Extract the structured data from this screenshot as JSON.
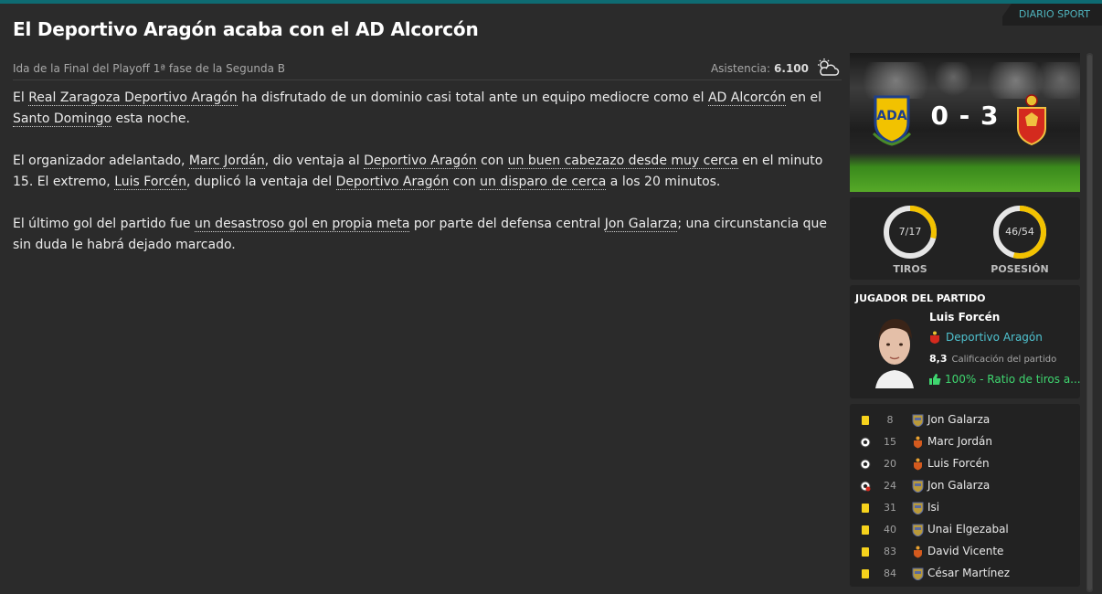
{
  "source": "DIARIO SPORT",
  "headline": "El Deportivo Aragón acaba con el AD Alcorcón",
  "round": "Ida de la Final del Playoff 1ª fase de la Segunda B",
  "attendance": {
    "label": "Asistencia:",
    "value": "6.100",
    "icon": "partly-cloudy-icon"
  },
  "article": {
    "p1": [
      "El ",
      "Real Zaragoza Deportivo Aragón",
      " ha disfrutado de un dominio casi total ante un equipo mediocre como el ",
      "AD Alcorcón",
      " en el ",
      "Santo Domingo",
      " esta noche."
    ],
    "p2": [
      "El organizador adelantado, ",
      "Marc Jordán",
      ", dio ventaja al ",
      "Deportivo Aragón",
      " con ",
      "un buen cabezazo desde muy cerca",
      " en el minuto 15. El extremo, ",
      "Luis Forcén",
      ", duplicó la ventaja del ",
      "Deportivo Aragón",
      " con ",
      "un disparo de cerca",
      " a los 20 minutos."
    ],
    "p3": [
      "El último gol del partido fue ",
      "un desastroso gol en propia meta",
      " por parte del defensa central ",
      "Jon Galarza",
      "; una circunstancia que sin duda le habrá dejado marcado."
    ]
  },
  "match": {
    "score": "0 - 3",
    "home_badge": "alcorcon-crest-icon",
    "away_badge": "zaragoza-crest-icon"
  },
  "stats": {
    "shots": {
      "value": "7/17",
      "label": "TIROS",
      "fraction": 0.29
    },
    "possession": {
      "value": "46/54",
      "label": "POSESIÓN",
      "fraction": 0.54
    }
  },
  "motm": {
    "title": "JUGADOR DEL PARTIDO",
    "name": "Luis Forcén",
    "club": "Deportivo Aragón",
    "rating": "8,3",
    "rating_label": "Calificación del partido",
    "stat": "100% - Ratio de tiros a..."
  },
  "events": [
    {
      "icon": "yellow-card-icon",
      "minute": "8",
      "badge": "alcorcon",
      "player": "Jon Galarza"
    },
    {
      "icon": "goal-ball-icon",
      "minute": "15",
      "badge": "zaragoza",
      "player": "Marc Jordán"
    },
    {
      "icon": "goal-ball-icon",
      "minute": "20",
      "badge": "zaragoza",
      "player": "Luis Forcén"
    },
    {
      "icon": "own-goal-icon",
      "minute": "24",
      "badge": "alcorcon",
      "player": "Jon Galarza"
    },
    {
      "icon": "yellow-card-icon",
      "minute": "31",
      "badge": "alcorcon",
      "player": "Isi"
    },
    {
      "icon": "yellow-card-icon",
      "minute": "40",
      "badge": "alcorcon",
      "player": "Unai Elgezabal"
    },
    {
      "icon": "yellow-card-icon",
      "minute": "83",
      "badge": "zaragoza",
      "player": "David Vicente"
    },
    {
      "icon": "yellow-card-icon",
      "minute": "84",
      "badge": "alcorcon",
      "player": "César Martínez"
    }
  ],
  "colors": {
    "accent": "#0e6b72",
    "gauge": "#f2c200",
    "link": "#4fc3d0",
    "positive": "#3fd66f",
    "card": "#f6d21c"
  }
}
